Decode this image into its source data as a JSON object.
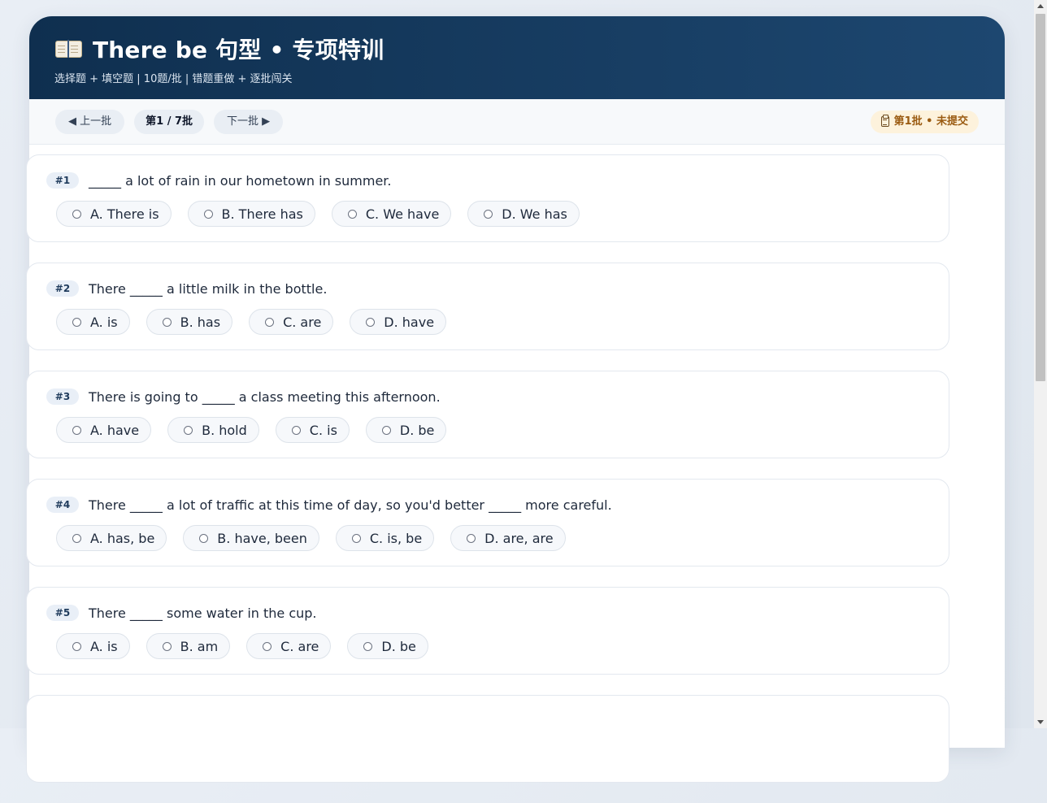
{
  "header": {
    "title": "There be 句型 • 专项特训",
    "subtitle": "选择题 + 填空题 | 10题/批 | 错题重做 + 逐批闯关"
  },
  "toolbar": {
    "prev_label": "◀ 上一批",
    "batch_counter": "第1 / 7批",
    "next_label": "下一批 ▶",
    "status": "第1批 • 未提交"
  },
  "questions": [
    {
      "num": "#1",
      "text": "_____ a lot of rain in our hometown in summer.",
      "options": [
        "A. There is",
        "B. There has",
        "C. We have",
        "D. We has"
      ]
    },
    {
      "num": "#2",
      "text": "There _____ a little milk in the bottle.",
      "options": [
        "A. is",
        "B. has",
        "C. are",
        "D. have"
      ]
    },
    {
      "num": "#3",
      "text": "There is going to _____ a class meeting this afternoon.",
      "options": [
        "A. have",
        "B. hold",
        "C. is",
        "D. be"
      ]
    },
    {
      "num": "#4",
      "text": "There _____ a lot of traffic at this time of day, so you'd better _____ more careful.",
      "options": [
        "A. has, be",
        "B. have, been",
        "C. is, be",
        "D. are, are"
      ]
    },
    {
      "num": "#5",
      "text": "There _____ some water in the cup.",
      "options": [
        "A. is",
        "B. am",
        "C. are",
        "D. be"
      ]
    }
  ],
  "icons": {
    "title": "book-icon",
    "status": "clipboard-icon"
  },
  "colors": {
    "header_start": "#0f2f4f",
    "header_end": "#1d4770",
    "status_bg": "#fdf2dc",
    "status_text": "#9a5a10"
  }
}
